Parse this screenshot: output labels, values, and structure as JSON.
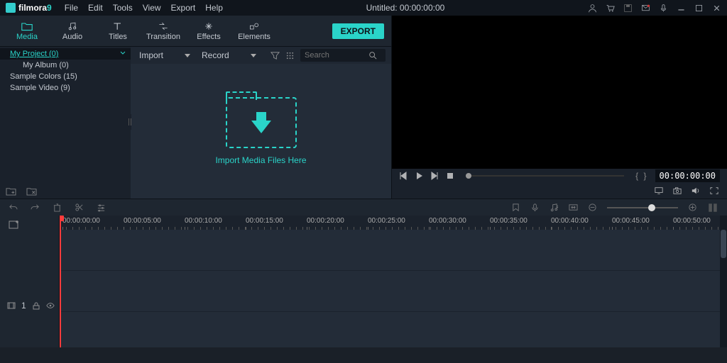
{
  "app": {
    "name": "filmora",
    "version": "9"
  },
  "titlebar": {
    "menu": [
      "File",
      "Edit",
      "Tools",
      "View",
      "Export",
      "Help"
    ],
    "title": "Untitled:  00:00:00:00"
  },
  "mode_tabs": [
    {
      "id": "media",
      "label": "Media",
      "active": true
    },
    {
      "id": "audio",
      "label": "Audio",
      "active": false
    },
    {
      "id": "titles",
      "label": "Titles",
      "active": false
    },
    {
      "id": "transition",
      "label": "Transition",
      "active": false
    },
    {
      "id": "effects",
      "label": "Effects",
      "active": false
    },
    {
      "id": "elements",
      "label": "Elements",
      "active": false
    }
  ],
  "export_label": "EXPORT",
  "media_tree": [
    {
      "label": "My Project (0)",
      "selected": true,
      "indent": 0
    },
    {
      "label": "My Album (0)",
      "selected": false,
      "indent": 1
    },
    {
      "label": "Sample Colors (15)",
      "selected": false,
      "indent": 0
    },
    {
      "label": "Sample Video (9)",
      "selected": false,
      "indent": 0
    }
  ],
  "media_toolbar": {
    "import_label": "Import",
    "record_label": "Record",
    "search_placeholder": "Search"
  },
  "drop_zone_text": "Import Media Files Here",
  "player": {
    "timecode": "00:00:00:00",
    "braces": "{  }"
  },
  "timeline": {
    "ticks": [
      "00:00:00:00",
      "00:00:05:00",
      "00:00:10:00",
      "00:00:15:00",
      "00:00:20:00",
      "00:00:25:00",
      "00:00:30:00",
      "00:00:35:00",
      "00:00:40:00",
      "00:00:45:00",
      "00:00:50:00"
    ],
    "track_index": "1"
  }
}
